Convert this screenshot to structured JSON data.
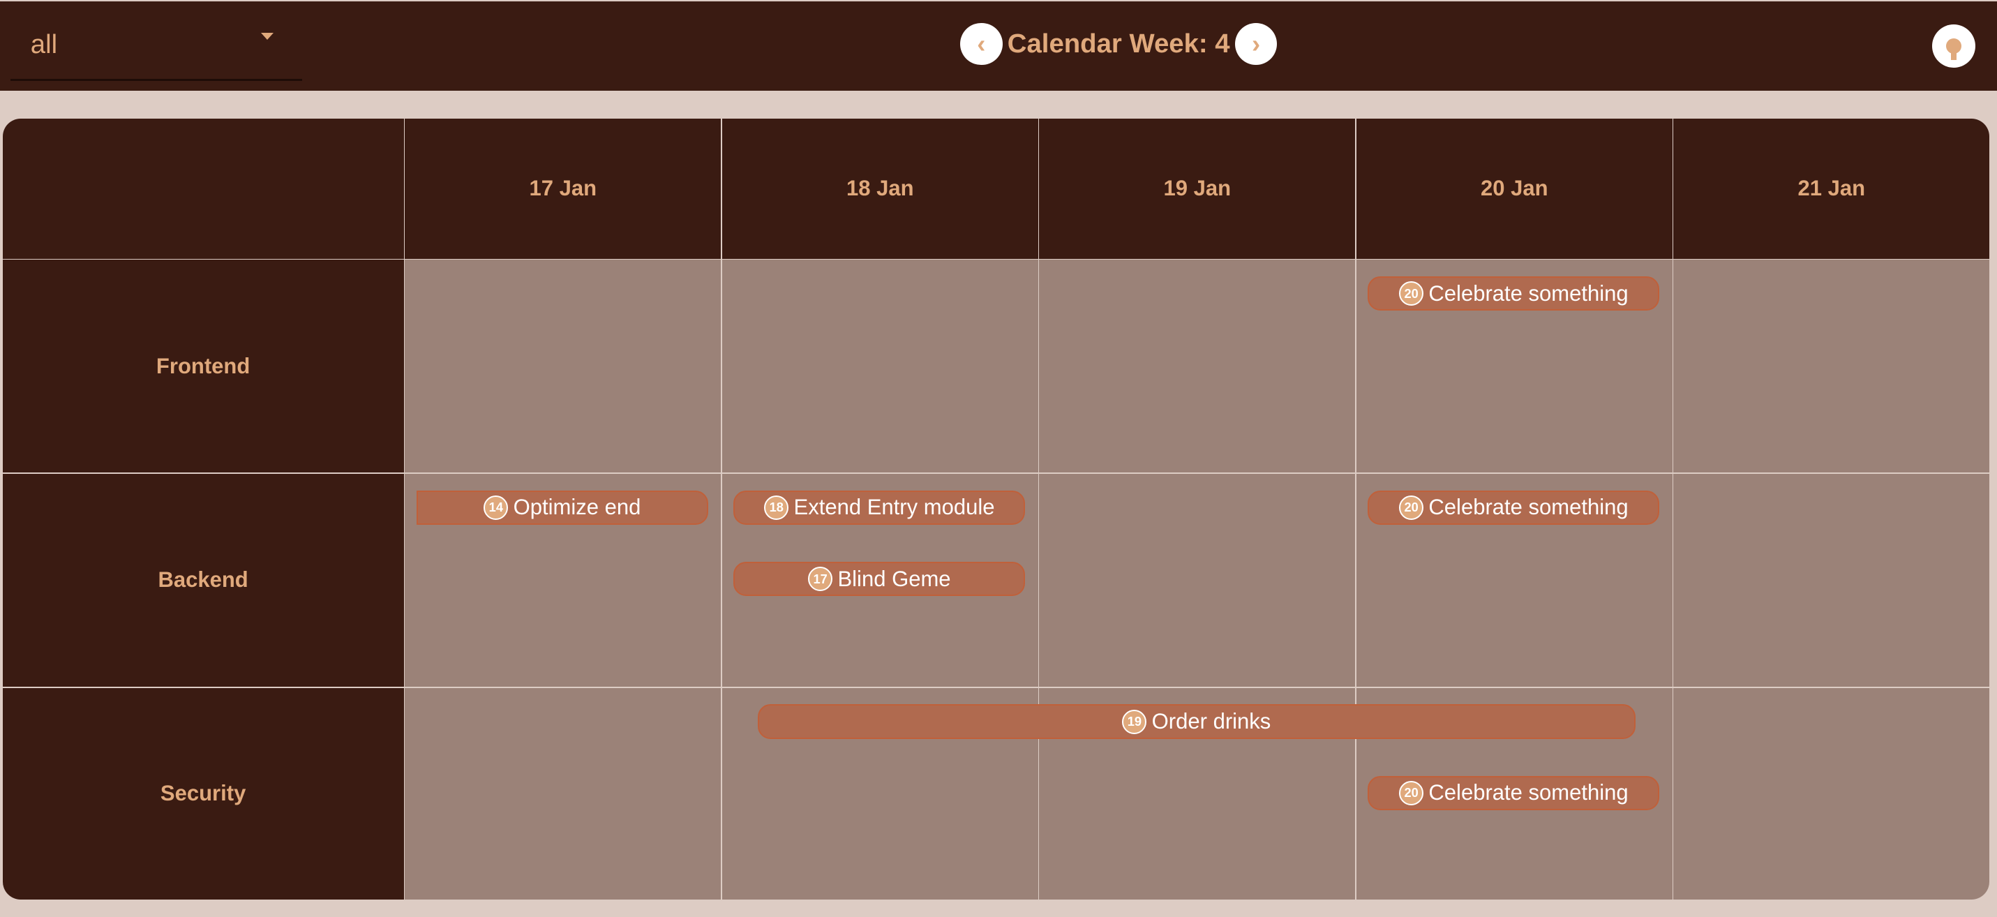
{
  "filter": {
    "value": "all"
  },
  "header": {
    "title": "Calendar Week: 4",
    "prev": "‹",
    "next": "›"
  },
  "days": [
    "17 Jan",
    "18 Jan",
    "19 Jan",
    "20 Jan",
    "21 Jan"
  ],
  "rows": [
    "Frontend",
    "Backend",
    "Security"
  ],
  "events": [
    {
      "id": "20",
      "title": "Celebrate something",
      "row": 0,
      "start": 3,
      "end": 3,
      "slot": 0
    },
    {
      "id": "14",
      "title": "Optimize end",
      "row": 1,
      "start": 0,
      "end": 0,
      "slot": 0,
      "continued": true
    },
    {
      "id": "18",
      "title": "Extend Entry module",
      "row": 1,
      "start": 1,
      "end": 1,
      "slot": 0
    },
    {
      "id": "17",
      "title": "Blind Geme",
      "row": 1,
      "start": 1,
      "end": 1,
      "slot": 1
    },
    {
      "id": "20",
      "title": "Celebrate something",
      "row": 1,
      "start": 3,
      "end": 3,
      "slot": 0
    },
    {
      "id": "19",
      "title": "Order drinks",
      "row": 2,
      "start": 1,
      "end": 3,
      "slot": 0
    },
    {
      "id": "20",
      "title": "Celebrate something",
      "row": 2,
      "start": 3,
      "end": 3,
      "slot": 1
    }
  ]
}
